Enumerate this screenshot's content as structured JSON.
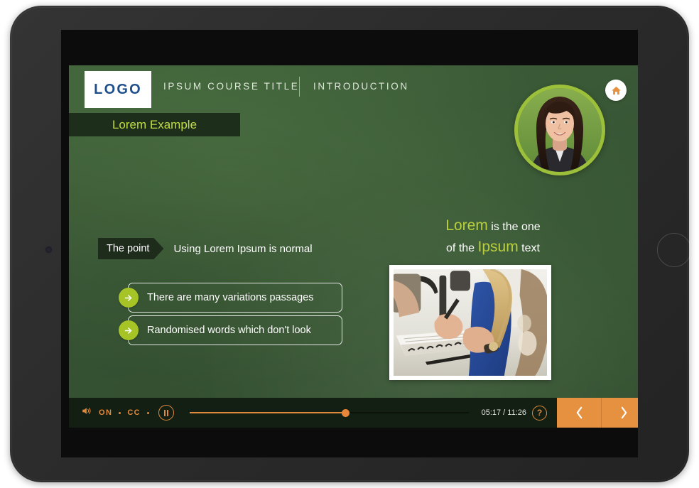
{
  "device": {
    "type": "tablet",
    "camera_icon": "camera-dot",
    "home_button_icon": "home-button-ring"
  },
  "header": {
    "logo_text": "LOGO",
    "course_title": "IPSUM COURSE TITLE",
    "section_title": "INTRODUCTION",
    "home_icon": "home-icon"
  },
  "avatar": {
    "alt": "instructor-portrait",
    "ring_color": "#9cc03a"
  },
  "banner": {
    "title": "Lorem Example"
  },
  "point": {
    "tag_label": "The point",
    "statement": "Using Lorem Ipsum is normal"
  },
  "bullets": [
    {
      "label": "There are many variations passages",
      "icon": "arrow-right-icon"
    },
    {
      "label": "Randomised words which don't look",
      "icon": "arrow-right-icon"
    }
  ],
  "right_text": {
    "line1_highlight": "Lorem",
    "line1_plain": "is the one",
    "line2_plain_before": "of the",
    "line2_highlight": "Ipsum",
    "line2_plain_after": "text"
  },
  "photo": {
    "alt": "students-writing-in-notebooks"
  },
  "controls": {
    "volume_icon": "volume-icon",
    "volume_state": "ON",
    "cc_label": "CC",
    "pause_icon": "pause-icon",
    "progress_percent": 56,
    "time_display": "05:17 / 11:26",
    "help_label": "?",
    "prev_icon": "chevron-left-icon",
    "next_icon": "chevron-right-icon"
  },
  "colors": {
    "accent_orange": "#e6913f",
    "accent_green": "#a6c426",
    "highlight_text": "#b9cf3d",
    "banner_bg": "#1d2e1b",
    "slide_green": "#395836",
    "logo_blue": "#1f4e8c"
  }
}
